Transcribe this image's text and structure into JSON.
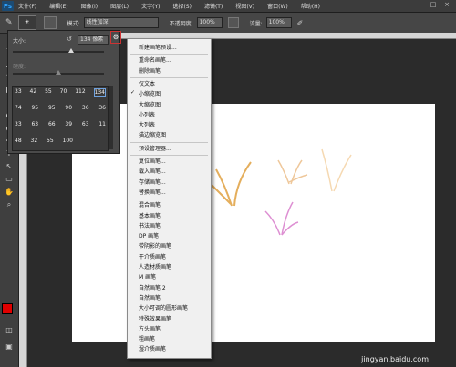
{
  "app": {
    "logo": "Ps"
  },
  "menu_bar": {
    "items": [
      "文件(F)",
      "编辑(E)",
      "图像(I)",
      "图层(L)",
      "文字(Y)",
      "选择(S)",
      "滤镜(T)",
      "视图(V)",
      "窗口(W)",
      "帮助(H)"
    ]
  },
  "options_bar": {
    "mode_label": "模式:",
    "mode_value": "线性加深",
    "opacity_label": "不透明度:",
    "opacity_value": "100%",
    "flow_label": "流量:",
    "flow_value": "100%"
  },
  "brush_panel": {
    "size_label": "大小:",
    "size_value": "134 像素",
    "hardness_label": "硬度:",
    "brush_sizes_row1": [
      "33",
      "42",
      "55",
      "70",
      "112",
      "134"
    ],
    "brush_sizes_row2": [
      "74",
      "95",
      "95",
      "90",
      "36",
      "36"
    ],
    "brush_sizes_row3": [
      "33",
      "63",
      "66",
      "39",
      "63",
      "11"
    ],
    "brush_sizes_row4": [
      "48",
      "32",
      "55",
      "100"
    ]
  },
  "context_menu": {
    "items": [
      {
        "label": "新建画笔预设...",
        "group": 0
      },
      {
        "label": "重命名画笔...",
        "group": 1
      },
      {
        "label": "删除画笔",
        "group": 1
      },
      {
        "label": "仅文本",
        "group": 2
      },
      {
        "label": "小缩览图",
        "group": 2,
        "checked": true
      },
      {
        "label": "大缩览图",
        "group": 2
      },
      {
        "label": "小列表",
        "group": 2
      },
      {
        "label": "大列表",
        "group": 2
      },
      {
        "label": "描边缩览图",
        "group": 2
      },
      {
        "label": "预设管理器...",
        "group": 3
      },
      {
        "label": "复位画笔...",
        "group": 4
      },
      {
        "label": "载入画笔...",
        "group": 4
      },
      {
        "label": "存储画笔...",
        "group": 4
      },
      {
        "label": "替换画笔...",
        "group": 4
      },
      {
        "label": "混合画笔",
        "group": 5
      },
      {
        "label": "基本画笔",
        "group": 5
      },
      {
        "label": "书法画笔",
        "group": 5
      },
      {
        "label": "DP 画笔",
        "group": 5
      },
      {
        "label": "带阴影的画笔",
        "group": 5
      },
      {
        "label": "干介质画笔",
        "group": 5
      },
      {
        "label": "人造材质画笔",
        "group": 5
      },
      {
        "label": "M 画笔",
        "group": 5
      },
      {
        "label": "自然画笔 2",
        "group": 5
      },
      {
        "label": "自然画笔",
        "group": 5
      },
      {
        "label": "大小可调的圆形画笔",
        "group": 5
      },
      {
        "label": "特殊效果画笔",
        "group": 5
      },
      {
        "label": "方头画笔",
        "group": 5
      },
      {
        "label": "粗画笔",
        "group": 5
      },
      {
        "label": "湿介质画笔",
        "group": 5
      }
    ]
  },
  "colors": {
    "foreground": "#e00000",
    "background": "#ffffff",
    "accent_highlight": "#cc3333"
  },
  "watermark": "jingyan.baidu.com"
}
